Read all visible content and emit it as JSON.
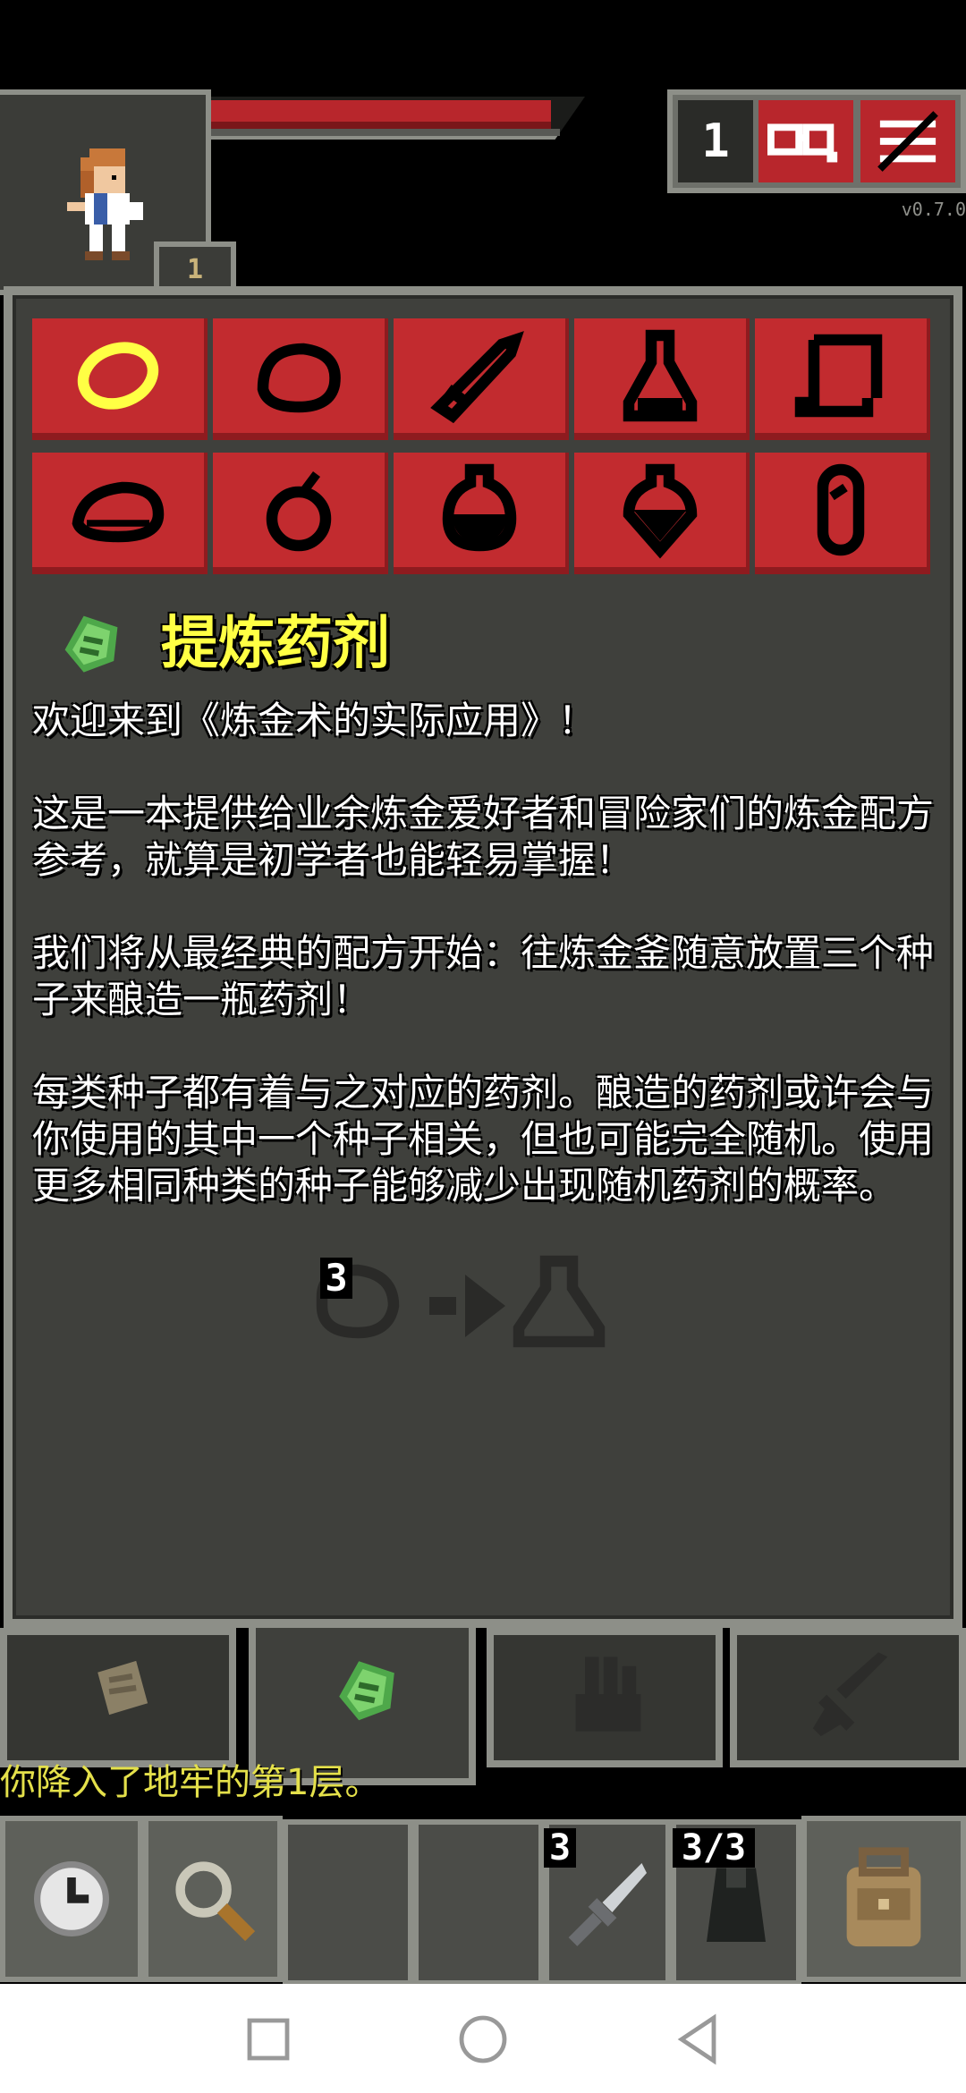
{
  "hud": {
    "depth": "1",
    "level": "1",
    "version": "v0.7.0",
    "hp_fraction": 1.0
  },
  "item_grid": [
    {
      "name": "ring",
      "selected": true
    },
    {
      "name": "stone"
    },
    {
      "name": "wand"
    },
    {
      "name": "potion-flask"
    },
    {
      "name": "scroll"
    },
    {
      "name": "food"
    },
    {
      "name": "bomb"
    },
    {
      "name": "round-potion"
    },
    {
      "name": "round-potion-2"
    },
    {
      "name": "spear-capsule"
    }
  ],
  "article": {
    "title": "提炼药剂",
    "paragraphs": [
      "欢迎来到《炼金术的实际应用》！",
      "这是一本提供给业余炼金爱好者和冒险家们的炼金配方参考，就算是初学者也能轻易掌握！",
      "我们将从最经典的配方开始：往炼金釜随意放置三个种子来酿造一瓶药剂！",
      "每类种子都有着与之对应的药剂。酿造的药剂或许会与你使用的其中一个种子相关，但也可能完全随机。使用更多相同种类的种子能够减少出现随机药剂的概率。"
    ],
    "formula_count": "3"
  },
  "tabs": [
    {
      "name": "scroll-tab-icon"
    },
    {
      "name": "seed-tab-icon",
      "active": true
    },
    {
      "name": "glove-tab-icon"
    },
    {
      "name": "sword-tab-icon"
    }
  ],
  "log": "你降入了地牢的第1层。",
  "toolbar": {
    "quickslot_1_count": "3",
    "quickslot_2_count": "3/3"
  },
  "colors": {
    "red": "#c22b2f",
    "panel": "#3f403c",
    "frame": "#8d8f88",
    "title_yellow": "#ffff44"
  }
}
